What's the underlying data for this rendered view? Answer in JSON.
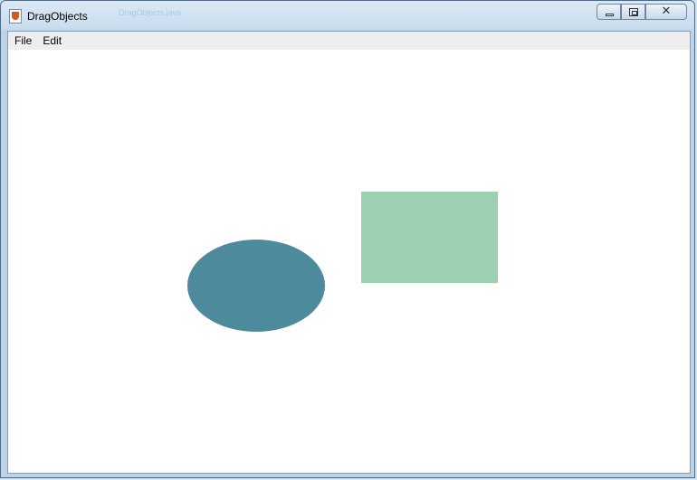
{
  "window": {
    "title": "DragObjects",
    "background_tab": "DragObjects.java",
    "controls": {
      "minimize_icon": "minimize-icon",
      "maximize_icon": "restore-icon",
      "close_glyph": "✕"
    }
  },
  "menubar": {
    "items": [
      {
        "label": "File"
      },
      {
        "label": "Edit"
      }
    ]
  },
  "canvas": {
    "shapes": [
      {
        "kind": "ellipse",
        "color": "#4d8a9b"
      },
      {
        "kind": "rectangle",
        "color": "#9bd1b1"
      }
    ]
  }
}
